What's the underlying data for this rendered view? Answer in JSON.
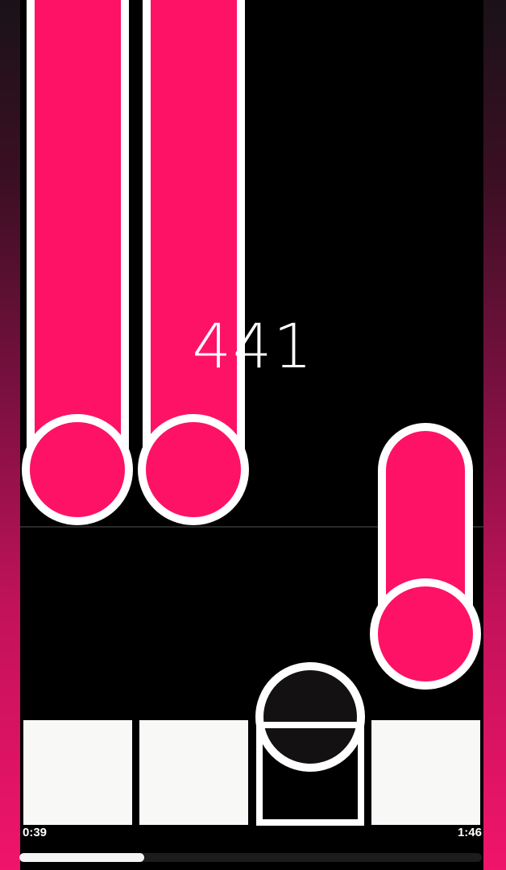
{
  "game": {
    "score": "441",
    "time_current": "0:39",
    "time_total": "1:46",
    "progress": 0.27
  },
  "colors": {
    "note_fill": "#fe1266",
    "outline": "#ffffff",
    "background": "#000000",
    "key": "#f8f8f6",
    "pressed_disc": "#131111"
  }
}
